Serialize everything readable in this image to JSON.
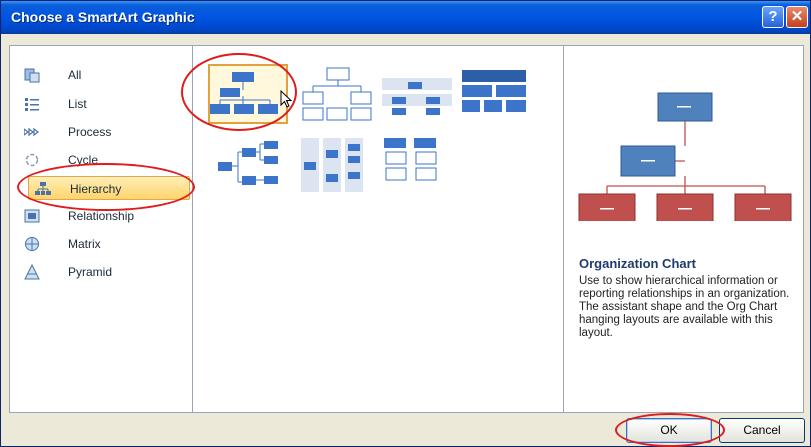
{
  "window": {
    "title": "Choose a SmartArt Graphic",
    "help_label": "?",
    "close_label": "✕"
  },
  "categories": [
    {
      "label": "All",
      "icon": "all-icon"
    },
    {
      "label": "List",
      "icon": "list-icon"
    },
    {
      "label": "Process",
      "icon": "process-icon"
    },
    {
      "label": "Cycle",
      "icon": "cycle-icon"
    },
    {
      "label": "Hierarchy",
      "icon": "hierarchy-icon",
      "selected": true
    },
    {
      "label": "Relationship",
      "icon": "relationship-icon"
    },
    {
      "label": "Matrix",
      "icon": "matrix-icon"
    },
    {
      "label": "Pyramid",
      "icon": "pyramid-icon"
    }
  ],
  "layouts": [
    {
      "name": "organization-chart",
      "selected": true
    },
    {
      "name": "hierarchy-outline"
    },
    {
      "name": "hierarchy-labeled"
    },
    {
      "name": "table-hierarchy"
    },
    {
      "name": "horizontal-hierarchy"
    },
    {
      "name": "horizontal-labeled-hierarchy"
    },
    {
      "name": "hierarchy-list"
    }
  ],
  "preview": {
    "title": "Organization Chart",
    "description": "Use to show hierarchical information or reporting relationships in an organization. The assistant shape and the Org Chart hanging layouts are available with this layout."
  },
  "buttons": {
    "ok": "OK",
    "cancel": "Cancel"
  },
  "colors": {
    "accent_blue": "#3b74c8",
    "preview_red": "#c0504d",
    "selection_gold": "#ffd46b",
    "annotation_red": "#e01b1b"
  }
}
